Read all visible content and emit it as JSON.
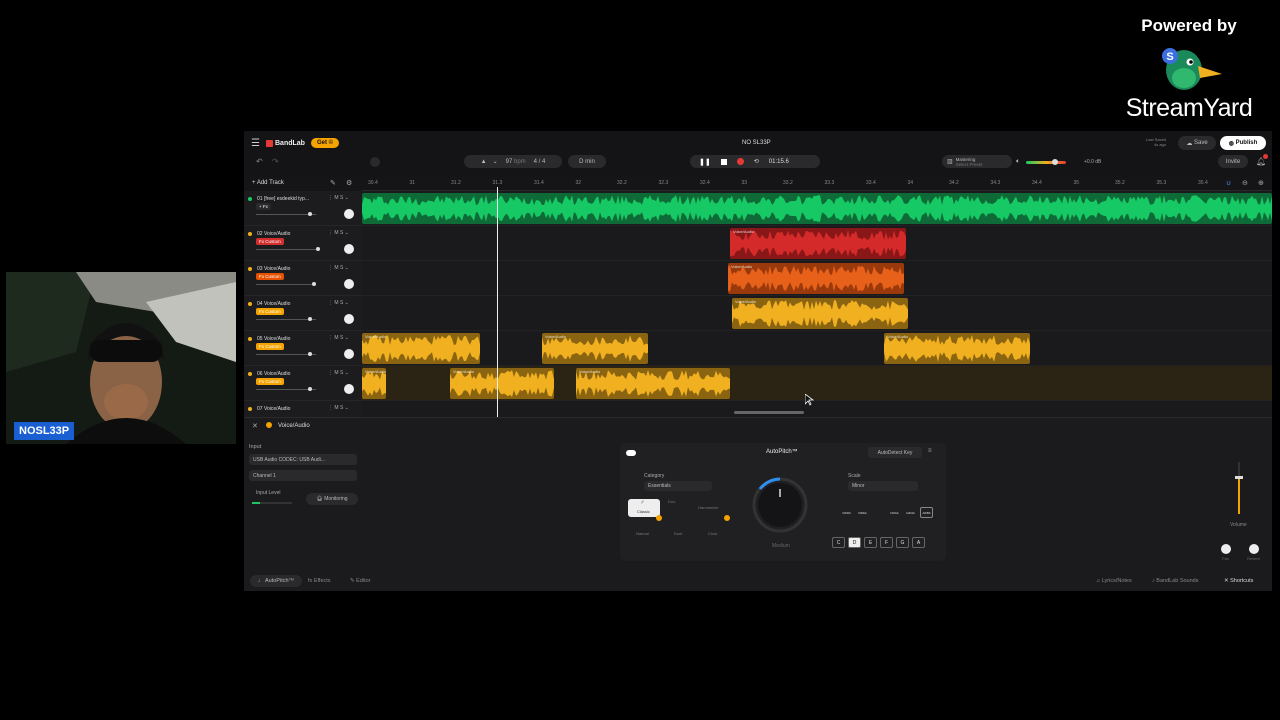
{
  "streamyard": {
    "powered_by": "Powered by",
    "brand": "StreamYard"
  },
  "webcam": {
    "label": "NOSL33P"
  },
  "topbar": {
    "app_name": "BandLab",
    "get_button": "Get",
    "project_title": "NO SL33P",
    "bpm": "97",
    "bpm_unit": "bpm",
    "time_sig": "4 / 4",
    "key": "D min",
    "time_display": "01:15.6",
    "mastering_label": "Mastering",
    "mastering_sub": "Select Preset",
    "db_label": "+0.0 dB",
    "last_saved": "Last Saved",
    "last_saved_time": "4s ago",
    "save_label": "Save",
    "publish_label": "Publish",
    "invite_label": "Invite"
  },
  "toolbar": {
    "add_track": "+ Add Track"
  },
  "ruler_ticks": [
    "30.4",
    "31",
    "31.2",
    "31.3",
    "31.4",
    "32",
    "32.2",
    "32.3",
    "32.4",
    "33",
    "33.2",
    "33.3",
    "33.4",
    "34",
    "34.2",
    "34.3",
    "34.4",
    "35",
    "35.2",
    "35.3",
    "35.4"
  ],
  "tracks": [
    {
      "name": "01 [free] esdeekid typ...",
      "fx": "+ Fx",
      "fx_color": "#2a2a2d"
    },
    {
      "name": "02 Voice/Audio",
      "fx": "Fx Custom",
      "fx_color": "#d32f2f"
    },
    {
      "name": "03 Voice/Audio",
      "fx": "Fx Custom",
      "fx_color": "#e65100"
    },
    {
      "name": "04 Voice/Audio",
      "fx": "Fx Custom",
      "fx_color": "#f5a300"
    },
    {
      "name": "05 Voice/Audio",
      "fx": "Fx Custom",
      "fx_color": "#f5a300"
    },
    {
      "name": "06 Voice/Audio",
      "fx": "Fx Custom",
      "fx_color": "#f5a300"
    },
    {
      "name": "07 Voice/Audio",
      "fx": "",
      "fx_color": "#2a2a2d"
    }
  ],
  "region_label": "Voice/Audio",
  "colors": {
    "green": "#17c964",
    "red": "#d42a2a",
    "orange": "#e8611a",
    "yellow": "#f0b020",
    "gold": "#d99a1e"
  },
  "editor": {
    "selected_track": "Voice/Audio",
    "input_label": "Input",
    "input_device": "USB Audio CODEC: USB Audi...",
    "channel": "Channel 1",
    "input_level": "Input Level",
    "monitoring": "Monitoring"
  },
  "autopitch": {
    "title": "AutoPitch™",
    "detect_key": "AutoDetect Key",
    "category_label": "Category",
    "category_value": "Essentials",
    "scale_label": "Scale",
    "scale_value": "Minor",
    "knob_label": "Medium",
    "modes": [
      "Classic",
      "Duo",
      "Harmonizer",
      "Natural",
      "Duet",
      "Choir"
    ],
    "keys": [
      "C",
      "D",
      "E",
      "F",
      "G",
      "A"
    ],
    "sharps": [
      "C#/Db",
      "D#/Eb",
      "F#/Gb",
      "G#/Ab",
      "A#/Bb"
    ]
  },
  "mixer": {
    "volume": "Volume",
    "pan": "Pan",
    "reverb": "Reverb"
  },
  "footer": {
    "tab1": "AutoPitch™",
    "tab2": "Effects",
    "tab3": "Editor",
    "lyrics": "Lyrics/Notes",
    "sounds": "BandLab Sounds",
    "shortcuts": "Shortcuts"
  }
}
